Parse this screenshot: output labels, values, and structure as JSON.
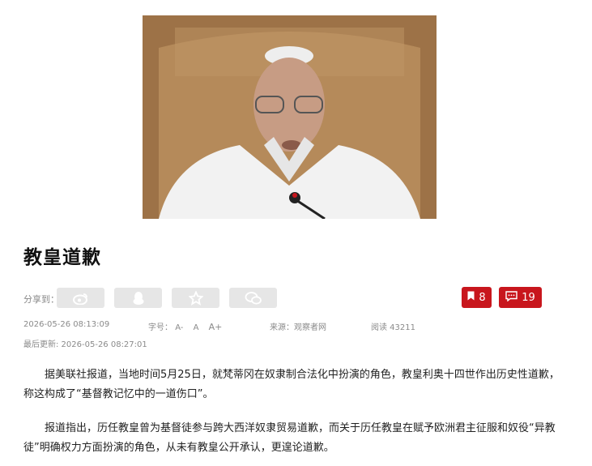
{
  "article": {
    "title": "教皇道歉",
    "share_label": "分享到：",
    "share_buttons": [
      "weibo-icon",
      "qq-icon",
      "favorite-icon",
      "wechat-icon"
    ],
    "bookmark_count": "8",
    "comment_count": "19",
    "publish_time": "2026-05-26 08:13:09",
    "font_size_label": "字号：",
    "font_sizes": [
      "A-",
      "A",
      "A+"
    ],
    "source": "来源：观察者网",
    "read_count": "阅读 43211",
    "last_updated": "最后更新: 2026-05-26 08:27:01",
    "paragraphs": [
      "据美联社报道，当地时间5月25日，就梵蒂冈在奴隶制合法化中扮演的角色，教皇利奥十四世作出历史性道歉，称这构成了“基督教记忆中的一道伤口”。",
      "报道指出，历任教皇曾为基督徒参与跨大西洋奴隶贸易道歉，而关于历任教皇在赋予欧洲君主征服和奴役“异教徒”明确权力方面扮演的角色，从未有教皇公开承认，更遑论道歉。"
    ]
  },
  "colors": {
    "accent": "#c8161d",
    "share_button_bg": "#e6e6e6",
    "meta_text": "#8a8a8a"
  }
}
